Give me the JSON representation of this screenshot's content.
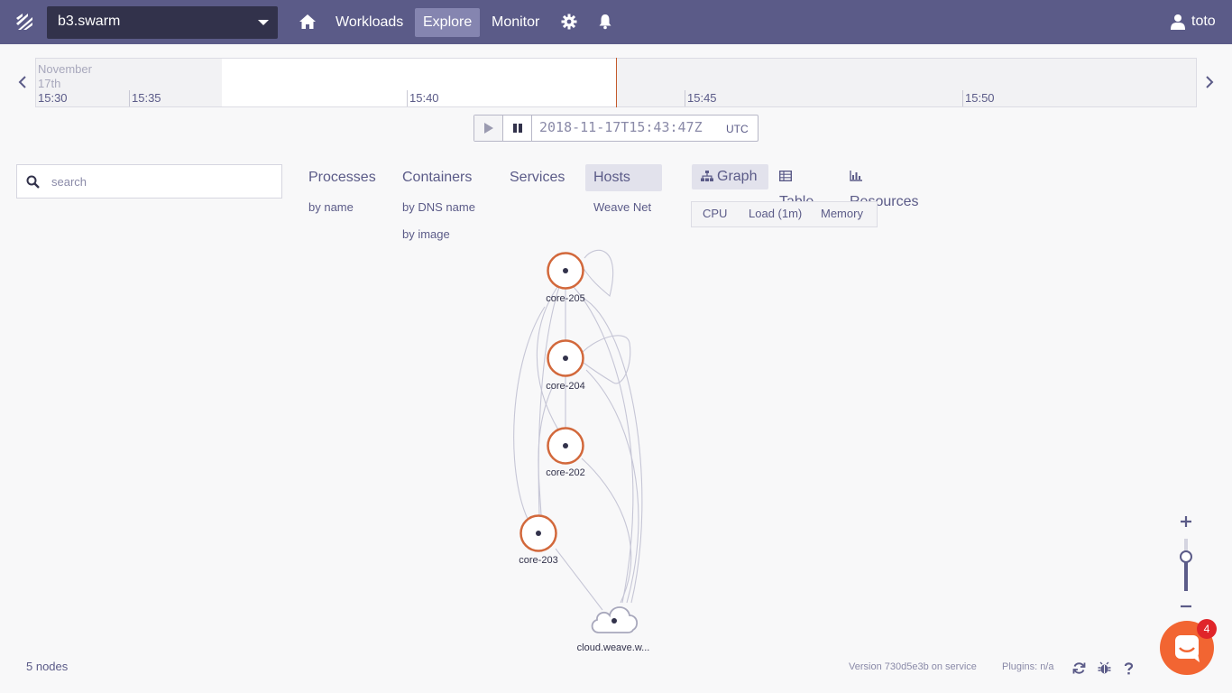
{
  "topbar": {
    "instance_name": "b3.swarm",
    "nav": [
      "Workloads",
      "Explore",
      "Monitor"
    ],
    "active_nav": "Explore",
    "user": "toto",
    "bg_color": "#5b5b88",
    "active_color": "#8585b0"
  },
  "timeline": {
    "month_label": "November 17th",
    "ticks": [
      "15:30",
      "15:35",
      "15:40",
      "15:45",
      "15:50"
    ],
    "timestamp": "2018-11-17T15:43:47Z",
    "timezone": "UTC"
  },
  "search": {
    "placeholder": "search",
    "value": ""
  },
  "topologies": {
    "processes": {
      "label": "Processes",
      "sub": [
        "by name"
      ]
    },
    "containers": {
      "label": "Containers",
      "sub": [
        "by DNS name",
        "by image"
      ]
    },
    "services": {
      "label": "Services"
    },
    "hosts": {
      "label": "Hosts",
      "sub": [
        "Weave Net"
      ]
    },
    "active": "Hosts"
  },
  "view_modes": [
    "Graph",
    "Table",
    "Resources"
  ],
  "active_view_mode": "Graph",
  "metrics": [
    "CPU",
    "Load (1m)",
    "Memory"
  ],
  "graph": {
    "nodes": [
      "core-205",
      "core-204",
      "core-202",
      "core-203",
      "cloud.weave.w..."
    ],
    "node_color": "#d2683b",
    "edge_color": "#c6c6d6"
  },
  "footer": {
    "node_count": "5 nodes",
    "version": "Version 730d5e3b on service",
    "plugins": "Plugins: n/a"
  },
  "chat": {
    "badge": "4",
    "color": "#f26532"
  }
}
